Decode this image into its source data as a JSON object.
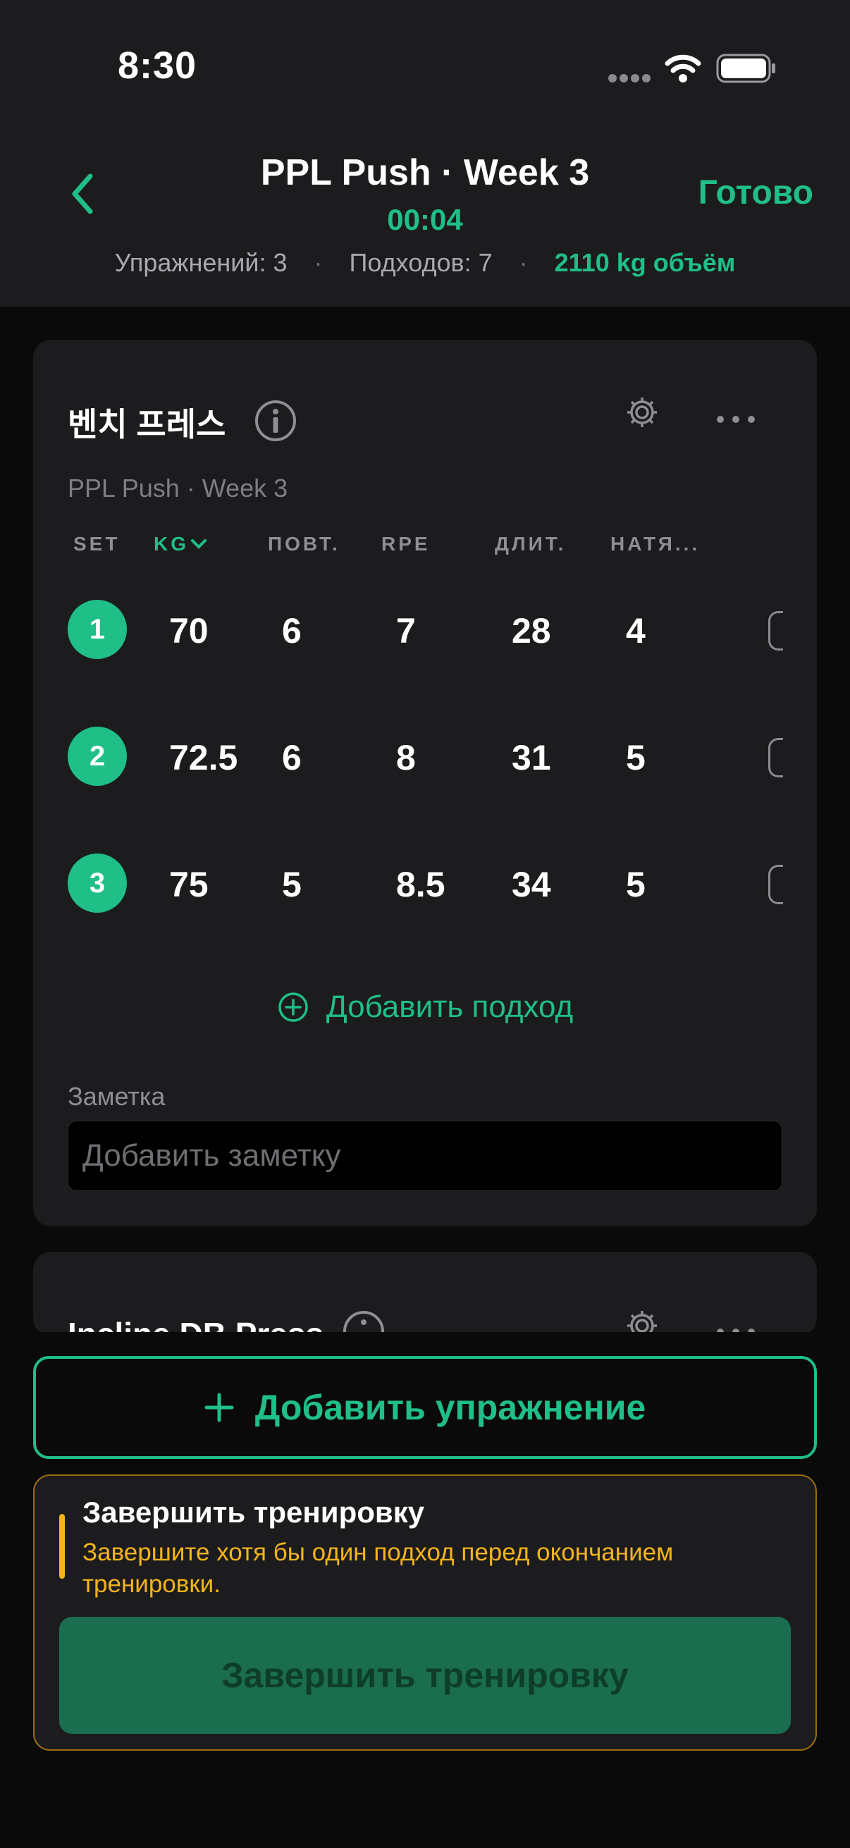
{
  "status_bar": {
    "time": "8:30"
  },
  "header": {
    "title": "PPL Push · Week 3",
    "timer": "00:04",
    "done_label": "Готово",
    "stats": {
      "exercises": "Упражнений: 3",
      "sets": "Подходов: 7",
      "volume": "2110 kg объём",
      "separator": "·"
    }
  },
  "exercises": [
    {
      "name": "벤치 프레스",
      "subtitle": "PPL Push · Week 3",
      "columns": [
        "SET",
        "KG",
        "ПОВТ.",
        "RPE",
        "ДЛИТ.",
        "НАТЯ..."
      ],
      "sets": [
        {
          "set": "1",
          "kg": "70",
          "reps": "6",
          "rpe": "7",
          "duration": "28",
          "tension": "4"
        },
        {
          "set": "2",
          "kg": "72.5",
          "reps": "6",
          "rpe": "8",
          "duration": "31",
          "tension": "5"
        },
        {
          "set": "3",
          "kg": "75",
          "reps": "5",
          "rpe": "8.5",
          "duration": "34",
          "tension": "5"
        }
      ],
      "add_set_label": "Добавить подход",
      "note_label": "Заметка",
      "note_placeholder": "Добавить заметку",
      "note_value": ""
    },
    {
      "name": "Incline DB Press"
    }
  ],
  "add_exercise_label": "Добавить упражнение",
  "finish": {
    "title": "Завершить тренировку",
    "message": "Завершите хотя бы один подход перед окончанием тренировки.",
    "button_label": "Завершить тренировку"
  },
  "icons": {
    "back": "chevron-left-icon",
    "info": "info-icon",
    "settings": "gear-icon",
    "more": "more-horizontal-icon",
    "add_set": "plus-circle-icon",
    "add_exercise": "plus-icon",
    "sort": "chevron-down-icon"
  },
  "colors": {
    "accent": "#1fbf87",
    "warning": "#f4b41a",
    "background": "#0a0a0b",
    "card": "#1c1c1e"
  }
}
